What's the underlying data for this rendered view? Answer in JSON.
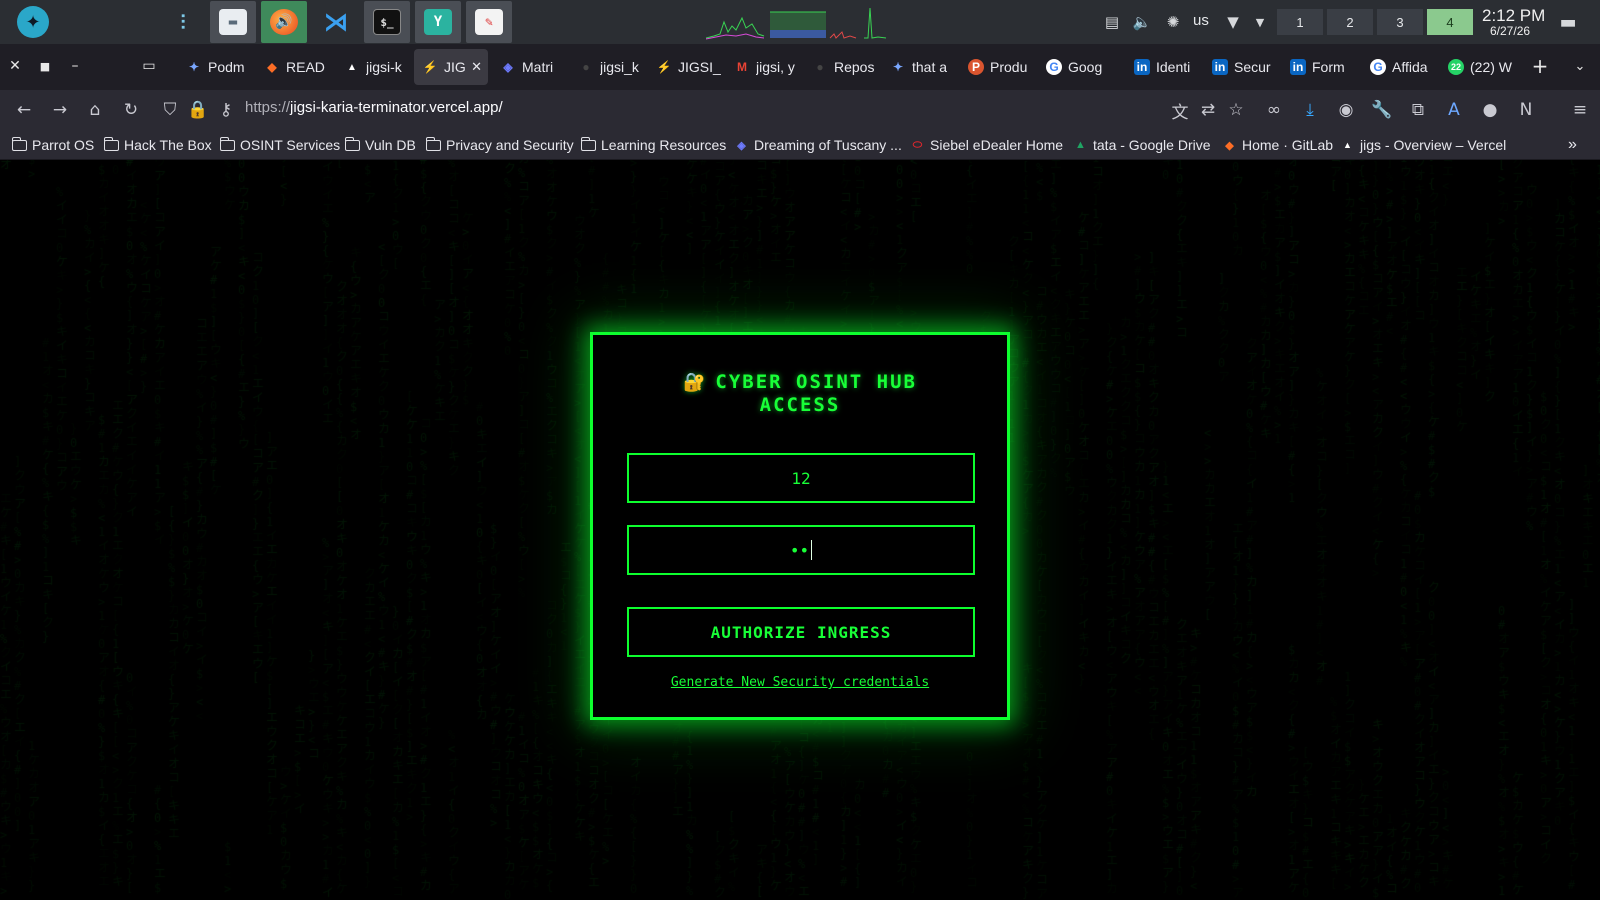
{
  "os_panel": {
    "workspaces": [
      "1",
      "2",
      "3",
      "4"
    ],
    "active_workspace": "4",
    "keyboard_layout": "us",
    "clock_time": "2:12 PM",
    "clock_date": "6/27/26"
  },
  "tabs": [
    {
      "label": "Podm",
      "icon": "gemini-icon"
    },
    {
      "label": "READ",
      "icon": "gitlab-icon"
    },
    {
      "label": "jigsi-k",
      "icon": "vercel-icon"
    },
    {
      "label": "JIGS",
      "icon": "bolt-icon",
      "active": true
    },
    {
      "label": "Matri",
      "icon": "matrix-icon"
    },
    {
      "label": "jigsi_k",
      "icon": "github-icon"
    },
    {
      "label": "JIGSI_",
      "icon": "bolt-icon"
    },
    {
      "label": "jigsi, y",
      "icon": "gmail-icon"
    },
    {
      "label": "Repos",
      "icon": "github-icon"
    },
    {
      "label": "that a",
      "icon": "gemini-icon"
    },
    {
      "label": "Produ",
      "icon": "product-icon"
    },
    {
      "label": "Goog",
      "icon": "google-icon"
    },
    {
      "label": "Identi",
      "icon": "linkedin-icon"
    },
    {
      "label": "Secur",
      "icon": "linkedin-icon"
    },
    {
      "label": "Form",
      "icon": "linkedin-icon"
    },
    {
      "label": "Affida",
      "icon": "google-icon"
    },
    {
      "label": "(22) W",
      "icon": "whatsapp-icon"
    }
  ],
  "address_bar": {
    "scheme": "https://",
    "host_path": "jigsi-karia-terminator.vercel.app/"
  },
  "bookmarks": [
    {
      "label": "Parrot OS",
      "icon": "folder-icon"
    },
    {
      "label": "Hack The Box",
      "icon": "folder-icon"
    },
    {
      "label": "OSINT Services",
      "icon": "folder-icon"
    },
    {
      "label": "Vuln DB",
      "icon": "folder-icon"
    },
    {
      "label": "Privacy and Security",
      "icon": "folder-icon"
    },
    {
      "label": "Learning Resources",
      "icon": "folder-icon"
    },
    {
      "label": "Dreaming of Tuscany ...",
      "icon": "bookmark-site-icon"
    },
    {
      "label": "Siebel eDealer Home",
      "icon": "oracle-icon"
    },
    {
      "label": "tata - Google Drive",
      "icon": "drive-icon"
    },
    {
      "label": "Home · GitLab",
      "icon": "gitlab-icon"
    },
    {
      "label": "jigs - Overview – Vercel",
      "icon": "vercel-icon"
    }
  ],
  "login": {
    "lock_emoji": "🔐",
    "title_line1": "CYBER OSINT HUB",
    "title_line2": "ACCESS",
    "username_value": "12",
    "password_masked": "••",
    "submit_label": "AUTHORIZE INGRESS",
    "generate_link": "Generate New Security credentials"
  },
  "colors": {
    "neon_green": "#0dff2e",
    "page_background": "#000000",
    "tabbar_background": "#1f1e25",
    "toolbar_background": "#2b2a33",
    "os_panel_background": "#2b2e33"
  }
}
